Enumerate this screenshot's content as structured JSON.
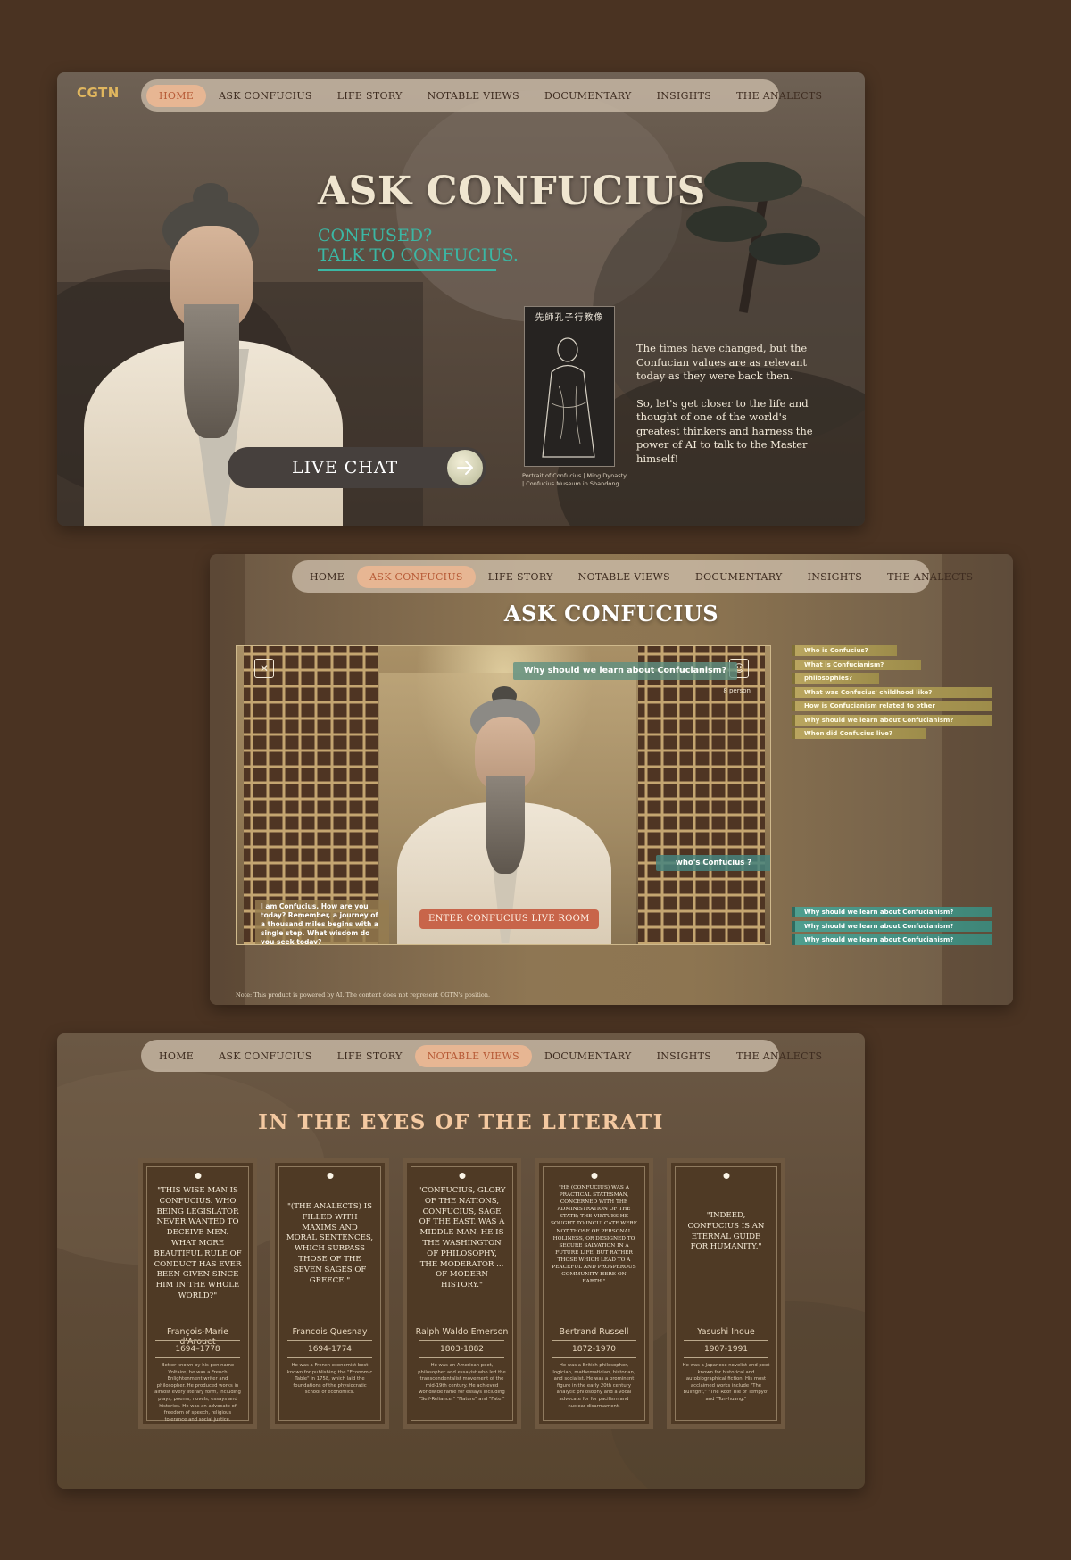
{
  "colors": {
    "background": "#4a3322",
    "nav_active_bg": "#e7b693",
    "nav_active_text": "#b75a36",
    "teal_accent": "#3bb7a4",
    "logo_gold": "#e0b65e",
    "literati_title": "#f4c9a1",
    "question_gold": "#b9a55f",
    "answer_teal": "#4f9e8f",
    "enter_button": "#c8654a"
  },
  "nav": {
    "items": [
      "HOME",
      "ASK CONFUCIUS",
      "LIFE STORY",
      "NOTABLE VIEWS",
      "DOCUMENTARY",
      "INSIGHTS",
      "THE ANALECTS"
    ]
  },
  "home": {
    "logo": "CGTN",
    "active_nav": "HOME",
    "title": "ASK CONFUCIUS",
    "subtitle_line1": "CONFUSED?",
    "subtitle_line2": "TALK TO CONFUCIUS.",
    "live_chat_label": "LIVE CHAT",
    "live_chat_icon": "arrow-right-icon",
    "portrait_inscription": "先師孔子行教像",
    "portrait_caption_line1": "Portrait of Confucius | Ming Dynasty",
    "portrait_caption_line2": "| Confucius Museum in Shandong",
    "paragraph1": "The times have changed, but the Confucian values are as relevant today as they were back then.",
    "paragraph2": "So, let's get closer to the life and thought of one of the world's greatest thinkers and harness the power of AI to talk to the Master himself!"
  },
  "ask": {
    "active_nav": "ASK CONFUCIUS",
    "title": "ASK CONFUCIUS",
    "mute_icon": "speaker-mute-icon",
    "person_icon": "person-icon",
    "person_count": "8 person",
    "question_bubble": "Why should we learn about Confucianism?",
    "who_bubble": "who's Confucius ?",
    "greeting": "I am Confucius. How are you today? Remember, a journey of a thousand miles begins with a single step. What wisdom do you seek today?",
    "enter_button": "ENTER CONFUCIUS LIVE ROOM",
    "questions": [
      "Who is Confucius?",
      "What is Confucianism?",
      "philosophies?",
      "What was Confucius' childhood like?",
      "How is Confucianism related to other",
      "Why should we learn about Confucianism?",
      "When did Confucius live?"
    ],
    "answers": [
      "Why should we learn about Confucianism?",
      "Why should we learn about Confucianism?",
      "Why should we learn about Confucianism?"
    ],
    "note": "Note: This product is powered by AI. The content does not represent CGTN's position."
  },
  "views": {
    "active_nav": "NOTABLE VIEWS",
    "title": "IN THE EYES OF THE LITERATI",
    "cards": [
      {
        "quote": "\"This wise man is Confucius. Who being legislator never wanted to deceive men. What more beautiful rule of conduct has ever been given since him in the whole world?\"",
        "name": "François-Marie d'Arouet",
        "years": "1694–1778",
        "bio": "Better known by his pen name Voltaire, he was a French Enlightenment writer and philosopher. He produced works in almost every literary form, including plays, poems, novels, essays and histories. He was an advocate of freedom of speech, religious tolerance and social justice."
      },
      {
        "quote": "\"(The Analects) is filled with maxims and moral sentences, which surpass those of the seven sages of Greece.\"",
        "name": "Francois Quesnay",
        "years": "1694-1774",
        "bio": "He was a French economist best known for publishing the \"Economic Table\" in 1758, which laid the foundations of the physiocratic school of economics."
      },
      {
        "quote": "\"Confucius, glory of the nations, Confucius, sage of the East, was a middle man. He is the Washington of philosophy, the moderator ... of modern history.\"",
        "name": "Ralph Waldo Emerson",
        "years": "1803-1882",
        "bio": "He was an American poet, philosopher and essayist who led the transcendentalist movement of the mid-19th century. He achieved worldwide fame for essays including \"Self-Reliance,\" \"Nature\" and \"Fate.\""
      },
      {
        "quote": "\"He (Confucius) was a practical statesman, concerned with the administration of the state; the virtues he sought to inculcate were not those of personal holiness, or designed to secure salvation in a future life, but rather those which lead to a peaceful and prosperous community here on earth.\"",
        "name": "Bertrand Russell",
        "years": "1872-1970",
        "bio": "He was a British philosopher, logician, mathematician, historian, and socialist. He was a prominent figure in the early 20th century analytic philosophy and a vocal advocate for for pacifism and nuclear disarmament."
      },
      {
        "quote": "\"Indeed, Confucius is an eternal guide for humanity.\"",
        "name": "Yasushi Inoue",
        "years": "1907-1991",
        "bio": "He was a Japanese novelist and poet known for historical and autobiographical fiction. His most acclaimed works include \"The Bullfight,\" \"The Roof Tile of Tempyo\" and \"Tun-huang.\""
      }
    ]
  }
}
